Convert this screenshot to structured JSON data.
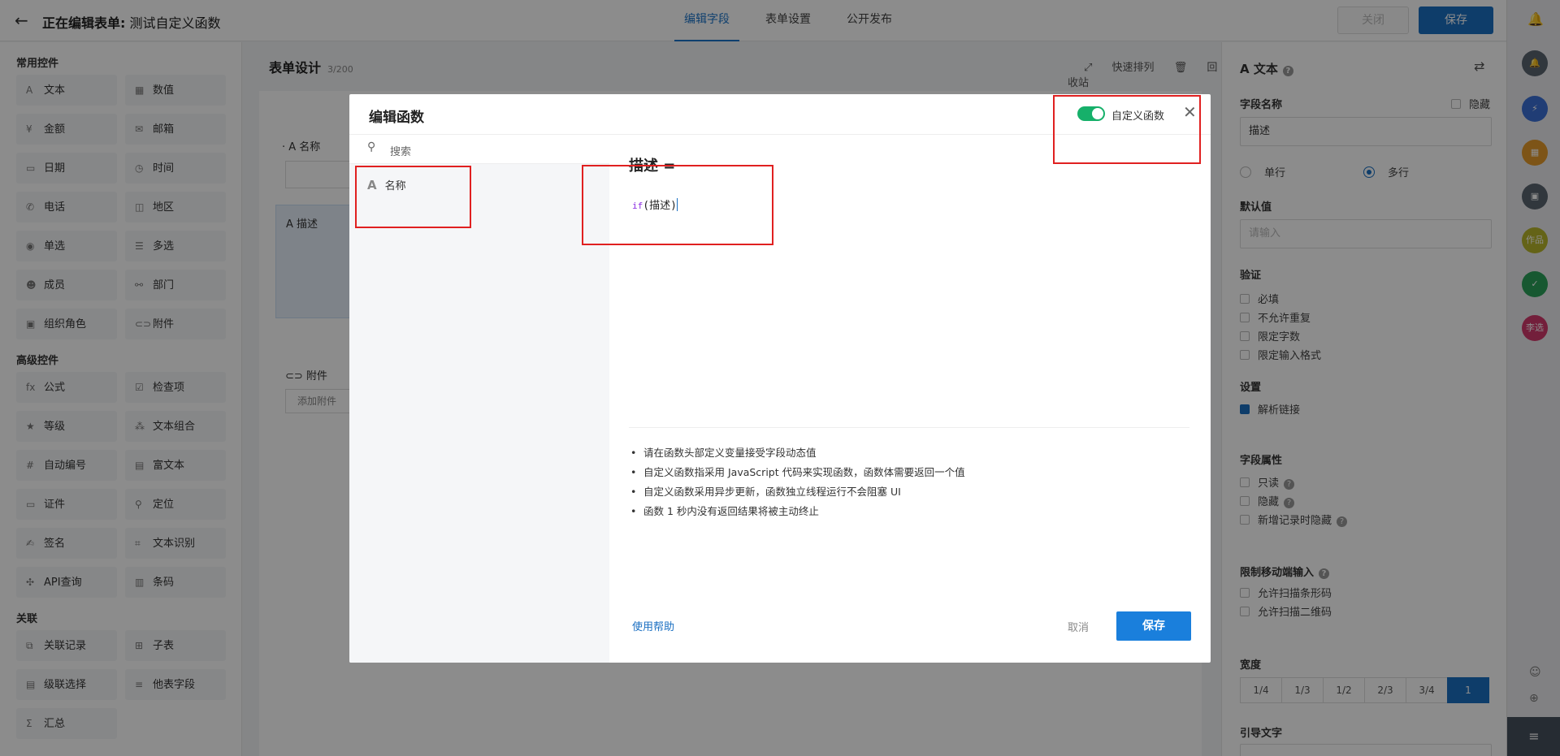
{
  "topbar": {
    "title_prefix": "正在编辑表单:",
    "title_name": "测试自定义函数",
    "tabs": [
      "编辑字段",
      "表单设置",
      "公开发布"
    ],
    "close_label": "关闭",
    "save_label": "保存"
  },
  "palette": {
    "common_title": "常用控件",
    "common": [
      {
        "icon": "A",
        "label": "文本"
      },
      {
        "icon": "▦",
        "label": "数值"
      },
      {
        "icon": "¥",
        "label": "金额"
      },
      {
        "icon": "✉",
        "label": "邮箱"
      },
      {
        "icon": "▭",
        "label": "日期"
      },
      {
        "icon": "◷",
        "label": "时间"
      },
      {
        "icon": "✆",
        "label": "电话"
      },
      {
        "icon": "◫",
        "label": "地区"
      },
      {
        "icon": "◉",
        "label": "单选"
      },
      {
        "icon": "☰",
        "label": "多选"
      },
      {
        "icon": "☻",
        "label": "成员"
      },
      {
        "icon": "⚯",
        "label": "部门"
      },
      {
        "icon": "▣",
        "label": "组织角色"
      },
      {
        "icon": "⊂⊃",
        "label": "附件"
      }
    ],
    "advanced_title": "高级控件",
    "advanced": [
      {
        "icon": "fx",
        "label": "公式"
      },
      {
        "icon": "☑",
        "label": "检查项"
      },
      {
        "icon": "★",
        "label": "等级"
      },
      {
        "icon": "⁂",
        "label": "文本组合"
      },
      {
        "icon": "#",
        "label": "自动编号"
      },
      {
        "icon": "▤",
        "label": "富文本"
      },
      {
        "icon": "▭",
        "label": "证件"
      },
      {
        "icon": "⚲",
        "label": "定位"
      },
      {
        "icon": "✍",
        "label": "签名"
      },
      {
        "icon": "⌗",
        "label": "文本识别"
      },
      {
        "icon": "✣",
        "label": "API查询"
      },
      {
        "icon": "▥",
        "label": "条码"
      }
    ],
    "relation_title": "关联",
    "relation": [
      {
        "icon": "⧉",
        "label": "关联记录"
      },
      {
        "icon": "⊞",
        "label": "子表"
      },
      {
        "icon": "▤",
        "label": "级联选择"
      },
      {
        "icon": "≡",
        "label": "他表字段"
      },
      {
        "icon": "Σ",
        "label": "汇总"
      }
    ]
  },
  "canvas": {
    "design_title": "表单设计",
    "design_count": "3/200",
    "tool_sort": "快速排列",
    "tool_bin": "回收站",
    "field1_label": "名称",
    "field2_label": "描述",
    "field3_label": "附件",
    "attach_btn": "添加附件"
  },
  "props": {
    "title": "文本",
    "field_name_label": "字段名称",
    "hide_label": "隐藏",
    "field_name_value": "描述",
    "single_line": "单行",
    "multi_line": "多行",
    "default_label": "默认值",
    "default_placeholder": "请输入",
    "validate_label": "验证",
    "validate": [
      "必填",
      "不允许重复",
      "限定字数",
      "限定输入格式"
    ],
    "settings_label": "设置",
    "parse_link": "解析链接",
    "attrs_label": "字段属性",
    "attr_readonly": "只读",
    "attr_hidden": "隐藏",
    "attr_hide_new": "新增记录时隐藏",
    "mobile_label": "限制移动端输入",
    "mobile": [
      "允许扫描条形码",
      "允许扫描二维码"
    ],
    "width_label": "宽度",
    "widths": [
      "1/4",
      "1/3",
      "1/2",
      "2/3",
      "3/4",
      "1"
    ],
    "guide_label": "引导文字"
  },
  "rail": {
    "items": [
      {
        "color": "#5a6470",
        "text": "🔔"
      },
      {
        "color": "#3b6fd6",
        "text": "⚡"
      },
      {
        "color": "#e39a2b",
        "text": "▦"
      },
      {
        "color": "#5a6470",
        "text": "▣"
      },
      {
        "color": "#b7b42a",
        "text": "作品"
      },
      {
        "color": "#2aa05a",
        "text": "✓"
      },
      {
        "color": "#d23a6c",
        "text": "李选"
      }
    ]
  },
  "modal": {
    "title": "编辑函数",
    "toggle_label": "自定义函数",
    "search_placeholder": "搜索",
    "field_name": "名称",
    "expr_title": "描述 =",
    "code_kw": "if",
    "code_arg": "(描述)",
    "tips": [
      "请在函数头部定义变量接受字段动态值",
      "自定义函数指采用 JavaScript 代码来实现函数，函数体需要返回一个值",
      "自定义函数采用异步更新，函数独立线程运行不会阻塞 UI",
      "函数 1 秒内没有返回结果将被主动终止"
    ],
    "help_link": "使用帮助",
    "cancel_label": "取消",
    "save_label": "保存"
  },
  "colors": {
    "accent": "#1a6fc2",
    "toggle_on": "#16b06a",
    "highlight": "#e02020"
  }
}
